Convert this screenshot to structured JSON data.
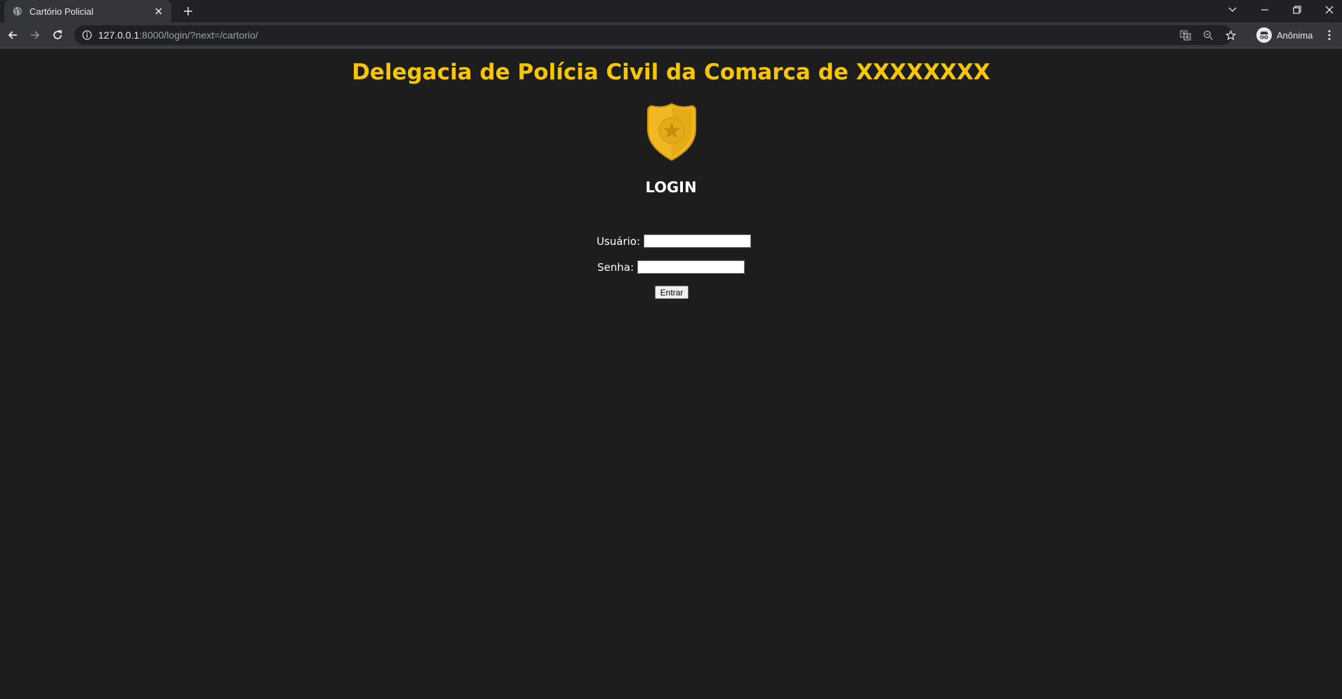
{
  "browser": {
    "tab": {
      "title": "Cartório Policial",
      "favicon": "globe-icon",
      "close_icon": "close-icon"
    },
    "new_tab_icon": "plus-icon",
    "window_controls": [
      "tab-search-icon",
      "minimize-icon",
      "restore-icon",
      "close-icon"
    ],
    "nav": {
      "back": "arrow-left-icon",
      "forward": "arrow-right-icon",
      "reload": "reload-icon"
    },
    "address": {
      "host": "127.0.0.1",
      "rest": ":8000/login/?next=/cartorio/",
      "info_icon": "info-icon"
    },
    "omnibox_icons": [
      "translate-icon",
      "zoom-icon",
      "star-icon"
    ],
    "profile": {
      "label": "Anônima",
      "icon": "incognito-icon"
    },
    "menu_icon": "kebab-menu-icon"
  },
  "page": {
    "title": "Delegacia de Polícia Civil da Comarca de XXXXXXXX",
    "badge_icon": "police-badge-icon",
    "login_heading": "LOGIN",
    "form": {
      "username_label": "Usuário:",
      "username_value": "",
      "password_label": "Senha:",
      "password_value": "",
      "submit_label": "Entrar"
    }
  },
  "colors": {
    "title": "#f7c600",
    "background": "#1d1d1d",
    "badge": "#f0b923"
  }
}
